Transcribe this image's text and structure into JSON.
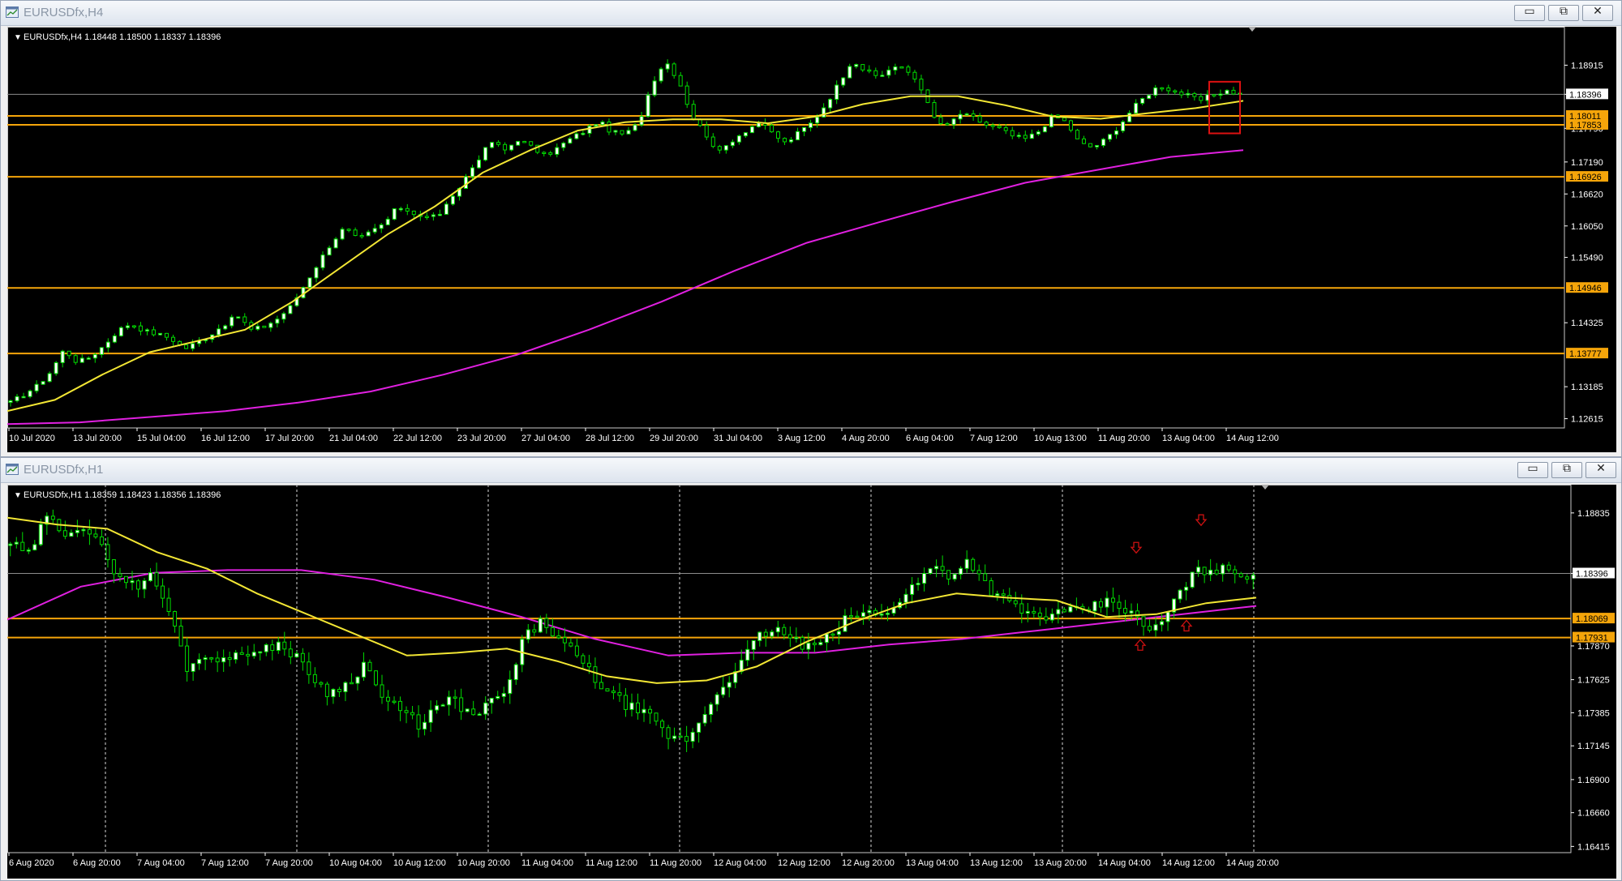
{
  "colors": {
    "background": "#000000",
    "bull_candle": "#ffffff",
    "bear_candle": "#000000",
    "wick": "#00dc00",
    "ma_fast": "#f2e634",
    "ma_slow": "#e020e0",
    "level_line": "#f5a50a",
    "price_line": "#8c8c8c",
    "text": "#ffffff",
    "marker": "#cc1111"
  },
  "windows": [
    {
      "title": "EURUSDfx,H4",
      "header": "EURUSDfx,H4  1.18448 1.18500 1.18337 1.18396",
      "buttons": {
        "minimize": "▭",
        "maximize": "⧉",
        "close": "✕"
      }
    },
    {
      "title": "EURUSDfx,H1",
      "header": "EURUSDfx,H1  1.18359 1.18423 1.18356 1.18396",
      "buttons": {
        "minimize": "▭",
        "maximize": "⧉",
        "close": "✕"
      }
    }
  ],
  "chart_data": [
    {
      "type": "candlestick",
      "symbol": "EURUSDfx",
      "timeframe": "H4",
      "ylim": [
        1.1245,
        1.196
      ],
      "y_ticks": [
        "1.18915",
        "1.18396",
        "1.17790",
        "1.17190",
        "1.16620",
        "1.16050",
        "1.15490",
        "1.14325",
        "1.13185",
        "1.12615"
      ],
      "x_ticks": [
        "10 Jul 2020",
        "13 Jul 20:00",
        "15 Jul 04:00",
        "16 Jul 12:00",
        "17 Jul 20:00",
        "21 Jul 04:00",
        "22 Jul 12:00",
        "23 Jul 20:00",
        "27 Jul 04:00",
        "28 Jul 12:00",
        "29 Jul 20:00",
        "31 Jul 04:00",
        "3 Aug 12:00",
        "4 Aug 20:00",
        "6 Aug 04:00",
        "7 Aug 12:00",
        "10 Aug 13:00",
        "11 Aug 20:00",
        "13 Aug 04:00",
        "14 Aug 12:00"
      ],
      "levels": [
        1.18011,
        1.17853,
        1.16926,
        1.14946,
        1.13777
      ],
      "level_labels": [
        "1.18011",
        "1.17853",
        "1.16926",
        "1.14946",
        "1.13777"
      ],
      "current_price": 1.18396,
      "current_price_label": "1.18396",
      "close_path": [
        1.129,
        1.1305,
        1.132,
        1.1345,
        1.1385,
        1.1362,
        1.1372,
        1.1392,
        1.1418,
        1.1432,
        1.1418,
        1.1412,
        1.1405,
        1.1386,
        1.1398,
        1.1412,
        1.143,
        1.1445,
        1.142,
        1.1426,
        1.144,
        1.1462,
        1.15,
        1.1538,
        1.1575,
        1.1602,
        1.158,
        1.1595,
        1.161,
        1.164,
        1.163,
        1.162,
        1.1625,
        1.165,
        1.169,
        1.1725,
        1.1755,
        1.174,
        1.176,
        1.1745,
        1.173,
        1.1745,
        1.1762,
        1.1775,
        1.1792,
        1.1772,
        1.1768,
        1.1788,
        1.186,
        1.19,
        1.1865,
        1.18,
        1.177,
        1.1735,
        1.1758,
        1.1775,
        1.179,
        1.177,
        1.1752,
        1.1772,
        1.179,
        1.1822,
        1.186,
        1.1902,
        1.188,
        1.187,
        1.189,
        1.1883,
        1.186,
        1.18,
        1.178,
        1.1805,
        1.1798,
        1.1785,
        1.1778,
        1.1765,
        1.176,
        1.1775,
        1.1802,
        1.179,
        1.1752,
        1.1745,
        1.176,
        1.1785,
        1.1815,
        1.1838,
        1.1856,
        1.1845,
        1.1838,
        1.1828,
        1.184,
        1.1846,
        1.184
      ],
      "ma_fast_path": [
        1.1275,
        1.1295,
        1.134,
        1.138,
        1.14,
        1.142,
        1.147,
        1.153,
        1.159,
        1.164,
        1.17,
        1.174,
        1.1775,
        1.179,
        1.1795,
        1.1795,
        1.1788,
        1.18,
        1.1822,
        1.1836,
        1.1836,
        1.182,
        1.18,
        1.1796,
        1.1806,
        1.1815,
        1.1828
      ],
      "ma_slow_path": [
        1.1252,
        1.1255,
        1.1265,
        1.1275,
        1.129,
        1.131,
        1.134,
        1.1375,
        1.142,
        1.147,
        1.1525,
        1.1575,
        1.1612,
        1.1648,
        1.1682,
        1.1705,
        1.1728,
        1.174
      ],
      "markers": [
        {
          "label": "selection-box",
          "near": "14 Aug 12:00"
        }
      ]
    },
    {
      "type": "candlestick",
      "symbol": "EURUSDfx",
      "timeframe": "H1",
      "ylim": [
        1.1637,
        1.1904
      ],
      "y_ticks": [
        "1.18835",
        "1.18396",
        "1.17870",
        "1.17625",
        "1.17385",
        "1.17145",
        "1.16900",
        "1.16660",
        "1.16415"
      ],
      "x_ticks": [
        "6 Aug 2020",
        "6 Aug 20:00",
        "7 Aug 04:00",
        "7 Aug 12:00",
        "7 Aug 20:00",
        "10 Aug 04:00",
        "10 Aug 12:00",
        "10 Aug 20:00",
        "11 Aug 04:00",
        "11 Aug 12:00",
        "11 Aug 20:00",
        "12 Aug 04:00",
        "12 Aug 12:00",
        "12 Aug 20:00",
        "13 Aug 04:00",
        "13 Aug 12:00",
        "13 Aug 20:00",
        "14 Aug 04:00",
        "14 Aug 12:00",
        "14 Aug 20:00"
      ],
      "levels": [
        1.18069,
        1.17931
      ],
      "level_labels": [
        "1.18069",
        "1.17931"
      ],
      "current_price": 1.18396,
      "current_price_label": "1.18396",
      "close_path": [
        1.1862,
        1.1852,
        1.188,
        1.187,
        1.1875,
        1.186,
        1.184,
        1.183,
        1.1838,
        1.181,
        1.177,
        1.1782,
        1.1775,
        1.1785,
        1.178,
        1.179,
        1.178,
        1.1765,
        1.1752,
        1.176,
        1.1775,
        1.1748,
        1.174,
        1.173,
        1.1742,
        1.1748,
        1.1735,
        1.1745,
        1.1755,
        1.1795,
        1.1805,
        1.179,
        1.1778,
        1.1762,
        1.175,
        1.1742,
        1.1735,
        1.1722,
        1.1718,
        1.1735,
        1.1758,
        1.177,
        1.1792,
        1.18,
        1.1792,
        1.1785,
        1.1792,
        1.1805,
        1.1812,
        1.1808,
        1.182,
        1.1832,
        1.1845,
        1.1838,
        1.185,
        1.183,
        1.182,
        1.1812,
        1.1808,
        1.181,
        1.1812,
        1.1815,
        1.182,
        1.1812,
        1.1798,
        1.1805,
        1.183,
        1.1842,
        1.1843,
        1.184,
        1.1839
      ],
      "ma_fast_path": [
        1.188,
        1.1875,
        1.1872,
        1.1855,
        1.1843,
        1.1825,
        1.181,
        1.1795,
        1.178,
        1.1782,
        1.1785,
        1.1776,
        1.1765,
        1.176,
        1.1762,
        1.1772,
        1.179,
        1.1805,
        1.1818,
        1.1825,
        1.1822,
        1.182,
        1.1808,
        1.181,
        1.1818,
        1.1822
      ],
      "ma_slow_path": [
        1.1806,
        1.183,
        1.184,
        1.1842,
        1.1842,
        1.1835,
        1.1822,
        1.1808,
        1.1792,
        1.178,
        1.1782,
        1.1782,
        1.1788,
        1.1792,
        1.1798,
        1.1804,
        1.181,
        1.1816
      ],
      "markers": [
        {
          "label": "down-arrow",
          "near": "14 Aug 04:00"
        },
        {
          "label": "down-arrow",
          "near": "14 Aug 12:00"
        },
        {
          "label": "up-arrow",
          "near": "14 Aug 08:00"
        },
        {
          "label": "up-arrow",
          "near": "14 Aug 12:00"
        }
      ]
    }
  ]
}
